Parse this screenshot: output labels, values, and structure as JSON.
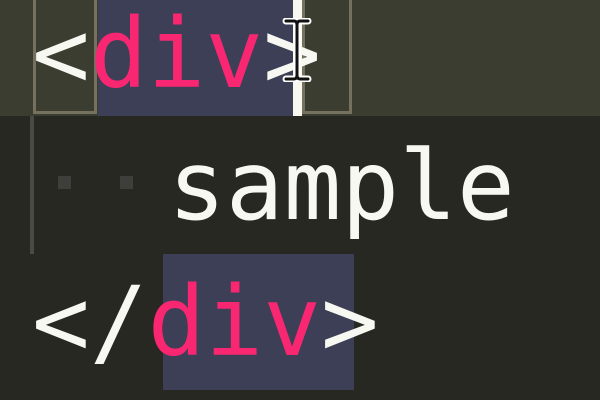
{
  "editor": {
    "line1": {
      "open_bracket": "<",
      "tag_name": "div",
      "close_bracket": ">"
    },
    "line2": {
      "text": "sample"
    },
    "line3": {
      "open_bracket": "</",
      "tag_name": "div",
      "close_bracket": ">"
    }
  },
  "colors": {
    "background": "#272822",
    "line_highlight": "#3a3d30",
    "tag": "#f92672",
    "text": "#f8f8f2",
    "selection": "#3c3f56",
    "bracket_match": "#75715e"
  },
  "cursor": {
    "icon": "ibeam-cursor-icon"
  }
}
